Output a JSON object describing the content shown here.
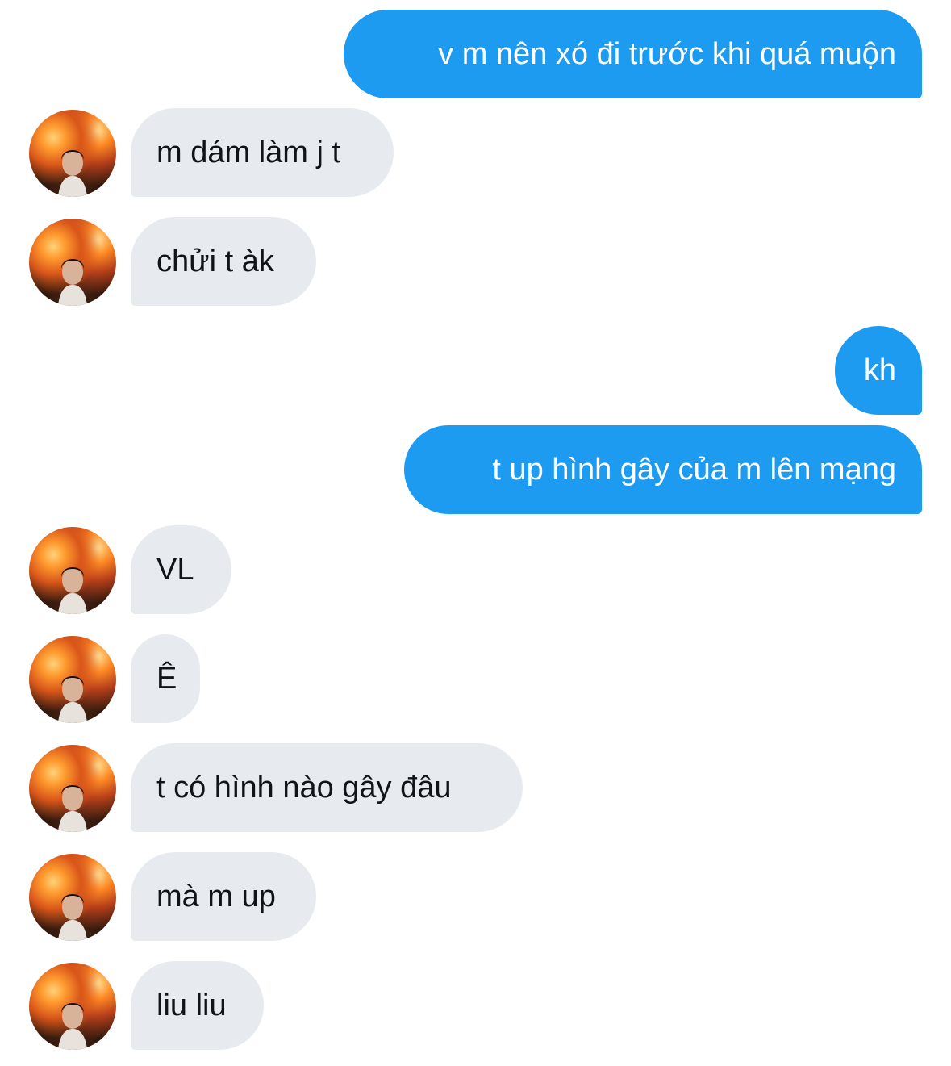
{
  "conversation": {
    "messages": [
      {
        "side": "sent",
        "text": "v m nên xó đi trước khi quá muộn"
      },
      {
        "side": "received",
        "text": "m dám làm j t"
      },
      {
        "side": "received",
        "text": "chửi t àk"
      },
      {
        "side": "sent",
        "text": "kh"
      },
      {
        "side": "sent",
        "text": "t up hình gây của m lên mạng"
      },
      {
        "side": "received",
        "text": "VL"
      },
      {
        "side": "received",
        "text": "Ê"
      },
      {
        "side": "received",
        "text": "t có hình nào gây đâu"
      },
      {
        "side": "received",
        "text": "mà m up"
      },
      {
        "side": "received",
        "text": "liu liu"
      }
    ]
  },
  "colors": {
    "sent_bubble": "#1d9bf0",
    "received_bubble": "#e7ebef",
    "sent_text": "#ffffff",
    "received_text": "#0f1419"
  },
  "icons": {
    "avatar": "profile-photo-person-with-fire-background"
  }
}
